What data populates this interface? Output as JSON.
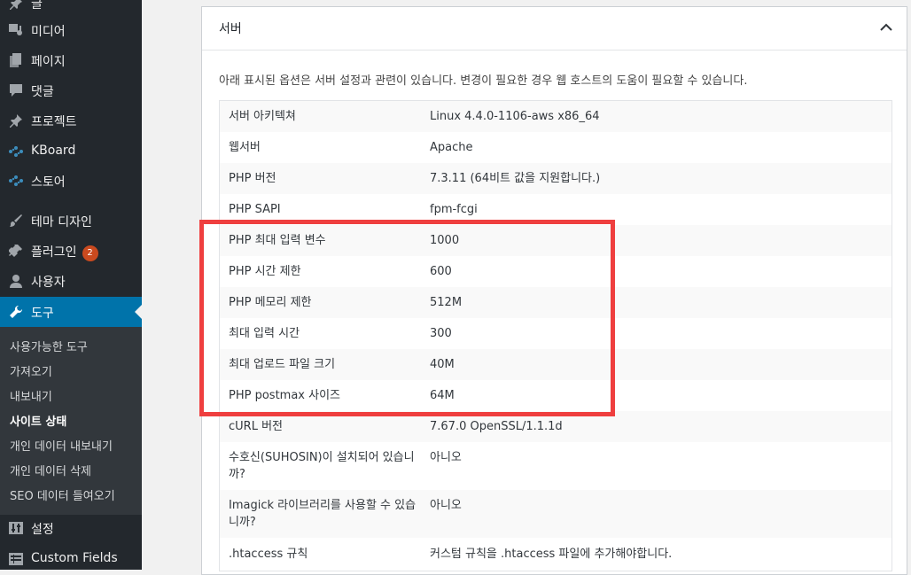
{
  "sidebar": {
    "items": [
      {
        "label": "글",
        "icon": "pushpin-icon"
      },
      {
        "label": "미디어",
        "icon": "media-icon"
      },
      {
        "label": "페이지",
        "icon": "page-icon"
      },
      {
        "label": "댓글",
        "icon": "comment-icon"
      },
      {
        "label": "프로젝트",
        "icon": "pushpin-icon"
      },
      {
        "label": "KBoard",
        "icon": "kboard-icon"
      },
      {
        "label": "스토어",
        "icon": "store-icon"
      },
      {
        "label": "테마 디자인",
        "icon": "brush-icon"
      },
      {
        "label": "플러그인",
        "icon": "plugin-icon",
        "badge": "2"
      },
      {
        "label": "사용자",
        "icon": "user-icon"
      },
      {
        "label": "도구",
        "icon": "wrench-icon"
      },
      {
        "label": "설정",
        "icon": "settings-icon"
      },
      {
        "label": "Custom Fields",
        "icon": "fields-icon"
      }
    ],
    "submenu": [
      {
        "label": "사용가능한 도구"
      },
      {
        "label": "가져오기"
      },
      {
        "label": "내보내기"
      },
      {
        "label": "사이트 상태"
      },
      {
        "label": "개인 데이터 내보내기"
      },
      {
        "label": "개인 데이터 삭제"
      },
      {
        "label": "SEO 데이터 들여오기"
      }
    ]
  },
  "panel": {
    "title": "서버",
    "description": "아래 표시된 옵션은 서버 설정과 관련이 있습니다. 변경이 필요한 경우 웹 호스트의 도움이 필요할 수 있습니다.",
    "rows": [
      {
        "key": "서버 아키텍쳐",
        "value": "Linux 4.4.0-1106-aws x86_64"
      },
      {
        "key": "웹서버",
        "value": "Apache"
      },
      {
        "key": "PHP 버전",
        "value": "7.3.11 (64비트 값을 지원합니다.)"
      },
      {
        "key": "PHP SAPI",
        "value": "fpm-fcgi"
      },
      {
        "key": "PHP 최대 입력 변수",
        "value": "1000"
      },
      {
        "key": "PHP 시간 제한",
        "value": "600"
      },
      {
        "key": "PHP 메모리 제한",
        "value": "512M"
      },
      {
        "key": "최대 입력 시간",
        "value": "300"
      },
      {
        "key": "최대 업로드 파일 크기",
        "value": "40M"
      },
      {
        "key": "PHP postmax 사이즈",
        "value": "64M"
      },
      {
        "key": "cURL 버전",
        "value": "7.67.0 OpenSSL/1.1.1d"
      },
      {
        "key": "수호신(SUHOSIN)이 설치되어 있습니까?",
        "value": "아니오"
      },
      {
        "key": "Imagick 라이브러리를 사용할 수 있습니까?",
        "value": "아니오"
      },
      {
        "key": ".htaccess 규칙",
        "value": "커스텀 규칙을 .htaccess 파일에 추가해야합니다."
      }
    ]
  },
  "colors": {
    "sidebar_bg": "#23282d",
    "active_bg": "#0073aa",
    "highlight": "#ef3f3f"
  }
}
